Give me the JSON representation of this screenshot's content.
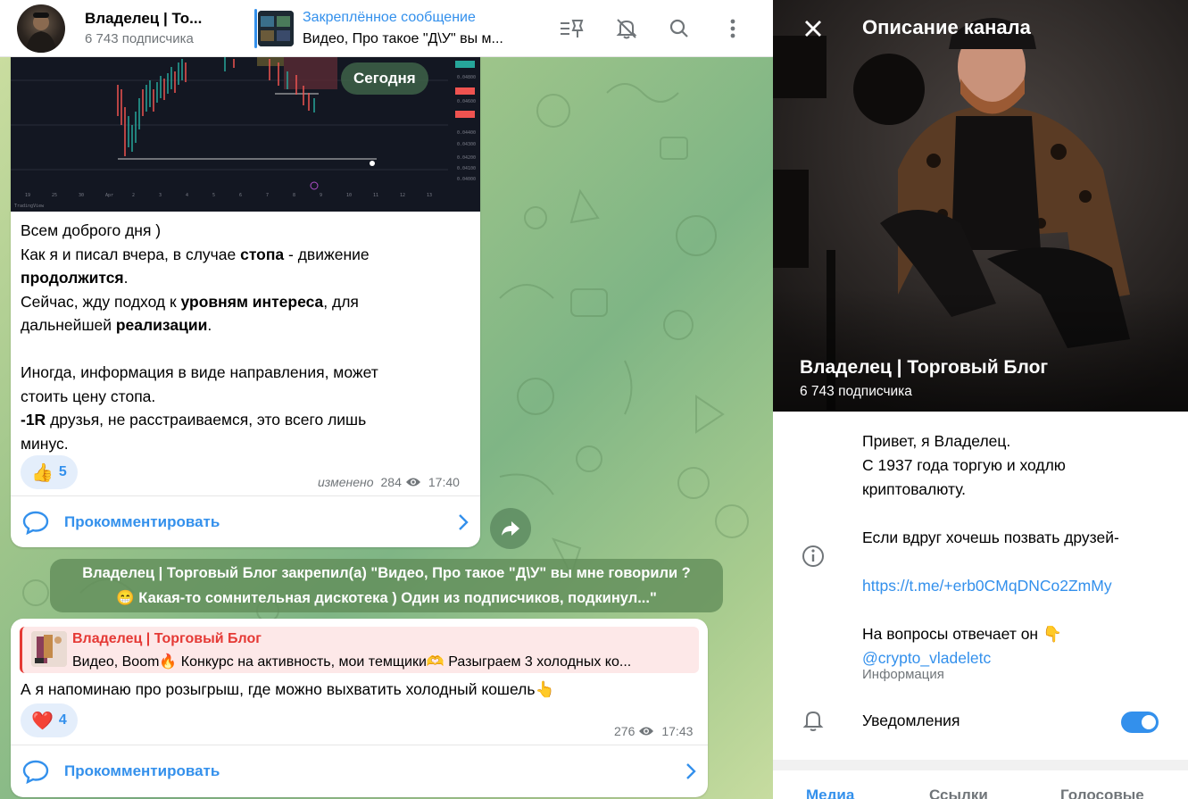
{
  "header": {
    "channel_title": "Владелец | То...",
    "channel_subscribers": "6 743 подписчика",
    "pinned_title": "Закреплённое сообщение",
    "pinned_text": "Видео, Про такое \"Д\\У\" вы м...",
    "icons": [
      "pinned-list-icon",
      "mute-icon",
      "search-icon",
      "more-icon"
    ]
  },
  "date_pill": "Сегодня",
  "message1": {
    "lines": [
      [
        {
          "t": "Всем доброго дня )",
          "b": false
        }
      ],
      [
        {
          "t": "Как я и писал вчера, в случае ",
          "b": false
        },
        {
          "t": "стопа",
          "b": true
        },
        {
          "t": " - движение",
          "b": false
        }
      ],
      [
        {
          "t": "продолжится",
          "b": true
        },
        {
          "t": ".",
          "b": false
        }
      ],
      [
        {
          "t": "Сейчас, жду подход к ",
          "b": false
        },
        {
          "t": "уровням интереса",
          "b": true
        },
        {
          "t": ", для",
          "b": false
        }
      ],
      [
        {
          "t": "дальнейшей ",
          "b": false
        },
        {
          "t": "реализации",
          "b": true
        },
        {
          "t": ".",
          "b": false
        }
      ],
      [
        {
          "t": "",
          "b": false
        }
      ],
      [
        {
          "t": "Иногда, информация в виде направления, может",
          "b": false
        }
      ],
      [
        {
          "t": "стоить цену стопа.",
          "b": false
        }
      ],
      [
        {
          "t": "-1R",
          "b": true
        },
        {
          "t": " друзья, не расстраиваемся, это всего лишь",
          "b": false
        }
      ],
      [
        {
          "t": "минус.",
          "b": false
        }
      ]
    ],
    "reaction_emoji": "👍",
    "reaction_count": "5",
    "edited_label": "изменено",
    "views": "284",
    "time": "17:40",
    "comment_label": "Прокомментировать"
  },
  "service_message": {
    "line1": "Владелец | Торговый Блог закрепил(а) \"Видео, Про такое \"Д\\У\" вы мне говорили ?",
    "line2": "😁 Какая-то сомнительная дискотека ) Один из подписчиков, подкинул...\""
  },
  "message2": {
    "quote_title": "Владелец | Торговый Блог",
    "quote_text": "Видео, Boom🔥 Конкурс на активность, мои темщики🫶 Разыграем 3 холодных ко...",
    "text": "А я напоминаю про розыгрыш, где можно выхватить холодный кошель👆",
    "reaction_emoji": "❤️",
    "reaction_count": "4",
    "views": "276",
    "time": "17:43",
    "comment_label": "Прокомментировать"
  },
  "panel": {
    "title": "Описание канала",
    "name": "Владелец | Торговый Блог",
    "subscribers": "6 743 подписчика",
    "desc_line1": "Привет, я Владелец.",
    "desc_line2": "С 1937 года торгую и ходлю",
    "desc_line3": "криптовалюту.",
    "desc_line4": "Если вдруг хочешь позвать друзей-",
    "link": "https://t.me/+erb0CMqDNCo2ZmMy",
    "desc_line5": "На вопросы отвечает он 👇",
    "mention": "@crypto_vladeletc",
    "info_label": "Информация",
    "notifications_label": "Уведомления",
    "notifications_on": true,
    "tabs": [
      "Медиа",
      "Ссылки",
      "Голосовые"
    ]
  },
  "colors": {
    "accent": "#3390ec",
    "quote_red": "#e53935",
    "chat_bg": "#9dc48a"
  }
}
